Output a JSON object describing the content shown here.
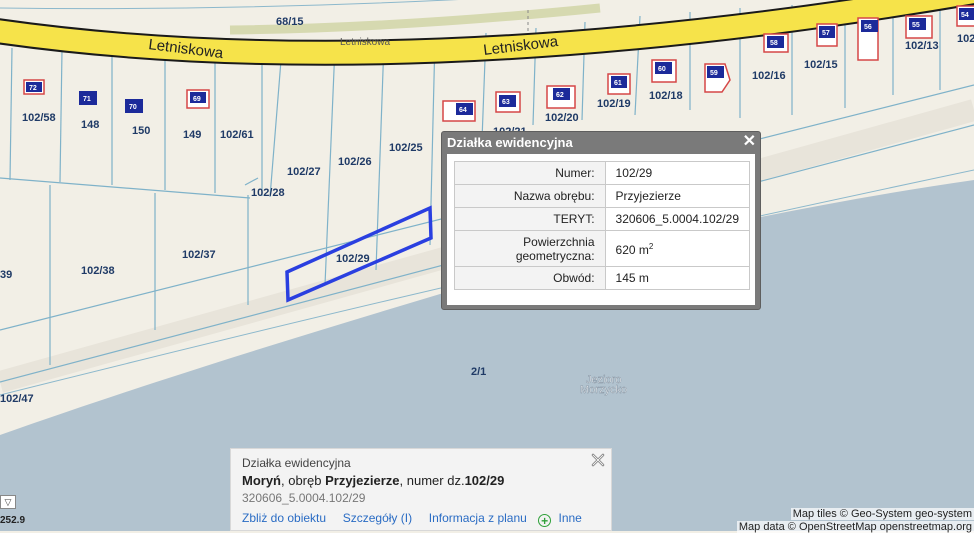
{
  "map": {
    "road_labels": [
      "68/15",
      "Letniskowa",
      "Letniskowa",
      "Letniskowa"
    ],
    "parcel_labels": [
      "102/58",
      "148",
      "150",
      "149",
      "102/61",
      "102/27",
      "102/26",
      "102/25",
      "102/28",
      "102/37",
      "102/38",
      "102/29",
      "2/1",
      "39",
      "102/47",
      "102/21",
      "102/20",
      "102/19",
      "102/18",
      "102/16",
      "102/15",
      "102/13",
      "102"
    ],
    "building_numbers": [
      "72",
      "71",
      "70",
      "69",
      "64",
      "63",
      "62",
      "61",
      "60",
      "59",
      "58",
      "57",
      "56",
      "55",
      "54"
    ],
    "lake_label_line1": "Jezioro",
    "lake_label_line2": "Morzycko",
    "colors": {
      "road": "#f6e34a",
      "water": "#b2c3cf",
      "land": "#f2efe6",
      "parcel_line": "#7fb2c9",
      "highlight": "#2a3fe0",
      "building": "#d54747",
      "number_box": "#1c2a9a"
    }
  },
  "popup": {
    "title": "Działka ewidencyjna",
    "close": "✕",
    "rows": [
      {
        "key": "Numer:",
        "value": "102/29"
      },
      {
        "key": "Nazwa obrębu:",
        "value": "Przyjezierze"
      },
      {
        "key": "TERYT:",
        "value": "320606_5.0004.102/29"
      },
      {
        "key_line1": "Powierzchnia",
        "key_line2": "geometryczna:",
        "value": "620 m",
        "value_sup": "2"
      },
      {
        "key": "Obwód:",
        "value": "145 m"
      }
    ]
  },
  "info": {
    "header": "Działka ewidencyjna",
    "town": "Moryń",
    "text_obreb": ", obręb ",
    "obreb": "Przyjezierze",
    "text_numer": ", numer dz.",
    "numer": "102/29",
    "teryt": "320606_5.0004.102/29",
    "links": [
      "Zbliż do obiektu",
      "Szczegóły (I)",
      "Informacja z planu",
      "Inne"
    ]
  },
  "scale": {
    "toggle": "▽",
    "value": "252.9"
  },
  "attribution": {
    "line1": "Map tiles © Geo-System geo-system",
    "line2": "Map data © OpenStreetMap openstreetmap.org"
  }
}
